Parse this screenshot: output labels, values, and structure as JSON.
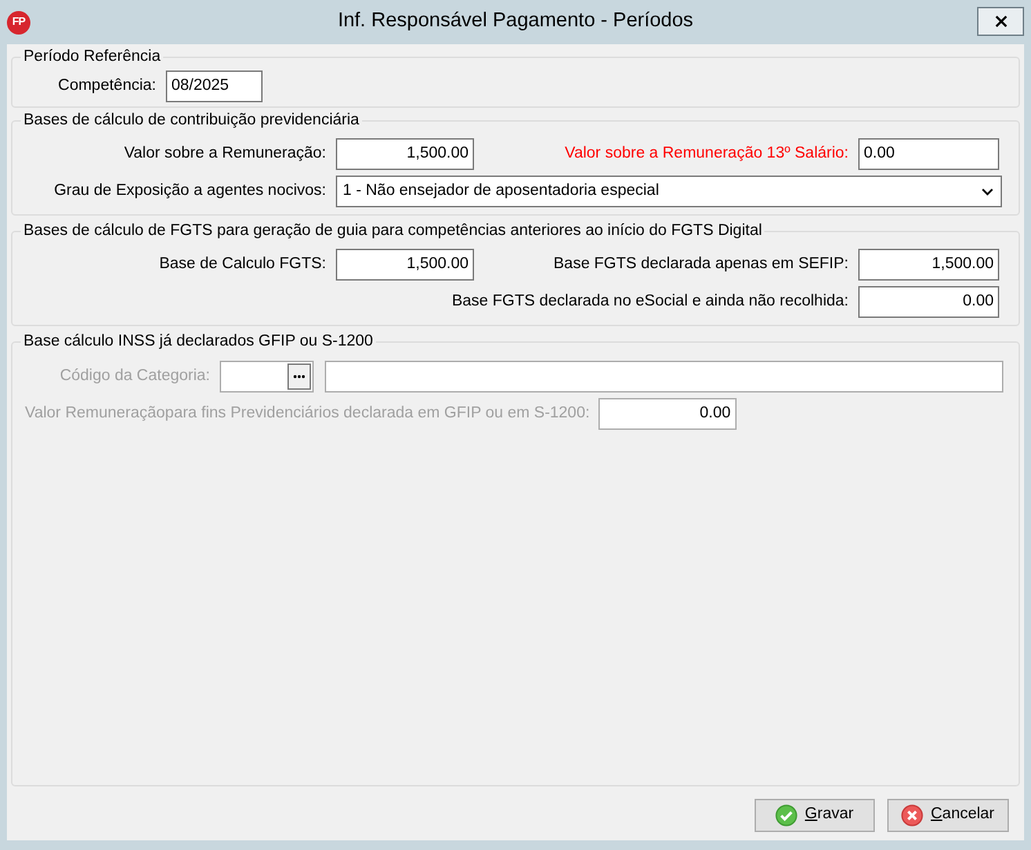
{
  "window": {
    "title": "Inf. Responsável Pagamento - Períodos",
    "icon_text": "FP"
  },
  "groups": [
    {
      "title": "Período Referência",
      "kind": "single",
      "rows": [
        {
          "left": {
            "kind": "text",
            "label": "Competência:",
            "value": "08/2025",
            "disabled": false,
            "highlighted": false
          }
        }
      ]
    },
    {
      "title": "Bases de cálculo de contribuição previdenciária",
      "kind": "grid",
      "rows": [
        {
          "left": {
            "kind": "amount",
            "label": "Valor sobre a Remuneração:",
            "value": "1,500.00",
            "disabled": false,
            "highlighted": false
          },
          "right": {
            "kind": "text",
            "label": "Valor sobre a Remuneração 13º Salário:",
            "value": "0.00",
            "disabled": false,
            "highlighted": true
          }
        },
        {
          "left": {
            "kind": "select",
            "label": "Grau de Exposição a agentes nocivos:",
            "value": "1 - Não ensejador de aposentadoria especial",
            "disabled": false,
            "highlighted": false
          }
        }
      ]
    },
    {
      "title": "Bases de cálculo de FGTS para geração de guia para competências anteriores ao início do FGTS Digital",
      "kind": "grid",
      "rows": [
        {
          "left": {
            "kind": "amount",
            "label": "Base de Calculo FGTS:",
            "value": "1,500.00",
            "disabled": false,
            "highlighted": false
          },
          "right": {
            "kind": "amount",
            "label": "Base FGTS declarada apenas em SEFIP:",
            "value": "1,500.00",
            "disabled": false,
            "highlighted": false
          }
        },
        {
          "right": {
            "kind": "amount",
            "label": "Base FGTS declarada no eSocial e ainda não recolhida:",
            "value": "0.00",
            "disabled": false,
            "highlighted": false
          }
        }
      ]
    },
    {
      "title": "Base cálculo INSS já declarados GFIP ou S-1200",
      "kind": "list",
      "rows": [
        {
          "left": {
            "kind": "lookup",
            "label": "Código da Categoria:",
            "disabled": true,
            "highlighted": false
          }
        },
        {
          "left": {
            "kind": "amount",
            "label": "Valor Remuneraçãopara fins Previdenciários declarada em GFIP ou em S-1200:",
            "value": "0.00",
            "disabled": true,
            "highlighted": false
          }
        }
      ]
    }
  ],
  "buttons": [
    {
      "label": "Gravar",
      "kind": "save"
    },
    {
      "label": "Cancelar",
      "kind": "cancel"
    }
  ]
}
